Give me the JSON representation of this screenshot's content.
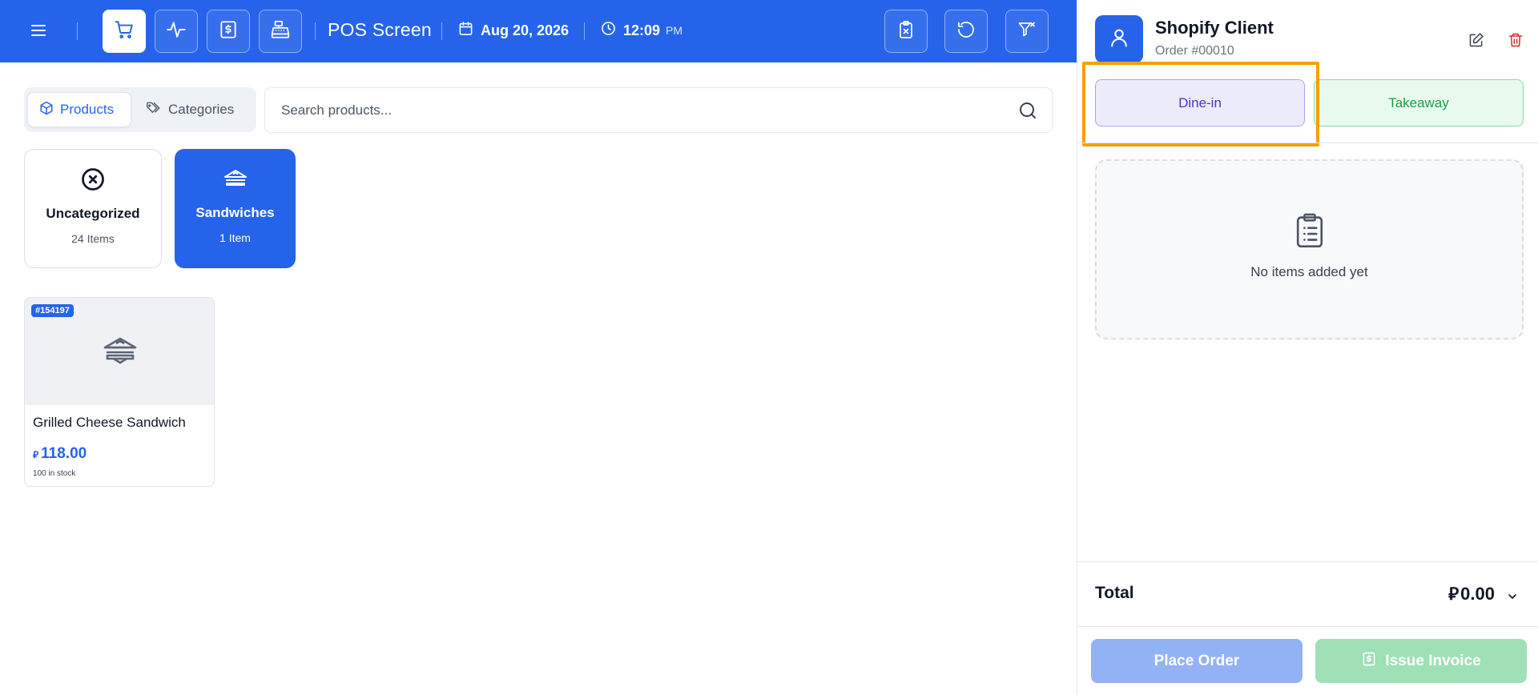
{
  "header": {
    "title": "POS Screen",
    "date": "Aug 20, 2026",
    "time": "12:09",
    "ampm": "PM",
    "icons": [
      "menu-icon",
      "cart-icon",
      "activity-icon",
      "receipt-icon",
      "cash-register-icon",
      "clipboard-x-icon",
      "undo-icon",
      "filter-x-icon",
      "calendar-icon",
      "clock-icon"
    ]
  },
  "tabs": {
    "products": "Products",
    "categories": "Categories",
    "active": "Products"
  },
  "search": {
    "placeholder": "Search products...",
    "value": ""
  },
  "categories": [
    {
      "name": "Uncategorized",
      "count": "24 Items",
      "icon": "x-circle-icon",
      "selected": false
    },
    {
      "name": "Sandwiches",
      "count": "1 Item",
      "icon": "sandwich-icon",
      "selected": true
    }
  ],
  "products": [
    {
      "badge": "#154197",
      "name": "Grilled Cheese Sandwich",
      "currency": "⃁",
      "price": "118.00",
      "stock": "100 in stock",
      "icon": "sandwich-icon"
    }
  ],
  "order_panel": {
    "client_name": "Shopify Client",
    "order_number": "Order #00010",
    "order_types": [
      "Dine-in",
      "Takeaway"
    ],
    "selected_type": "Dine-in",
    "empty_text": "No items added yet",
    "total_label": "Total",
    "total_currency": "⃁",
    "total_value": "0.00",
    "place_order": "Place Order",
    "issue_invoice": "Issue Invoice"
  },
  "colors": {
    "primary": "#2563eb",
    "highlight": "#f5a000",
    "dine_bg": "#ecebfb",
    "takeaway_bg": "#e8f9ee",
    "delete": "#dc2626"
  }
}
